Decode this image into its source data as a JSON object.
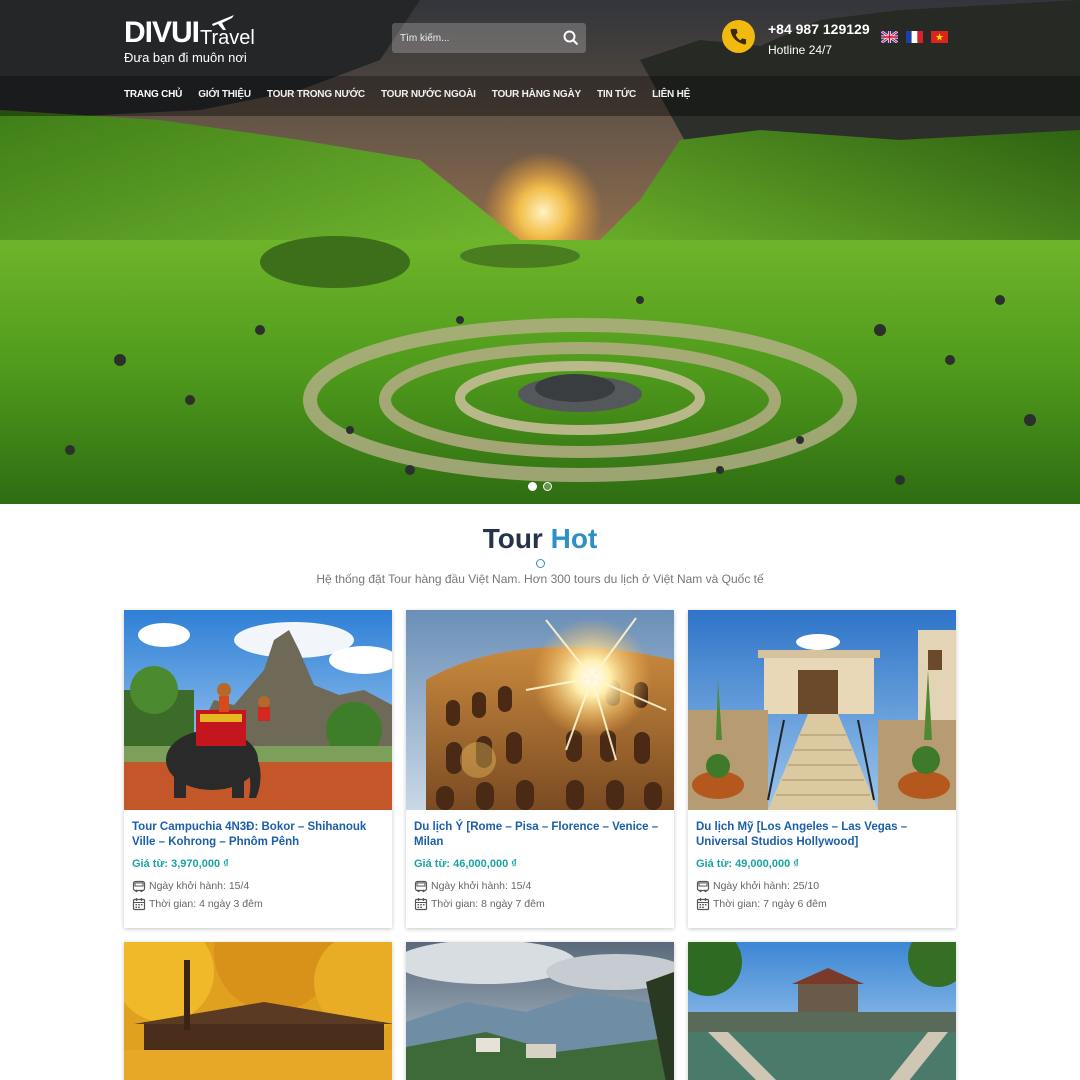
{
  "brand": {
    "name": "DIVUI",
    "sub": "Travel",
    "tagline": "Đưa bạn đi muôn nơi"
  },
  "search": {
    "placeholder": "Tìm kiếm..."
  },
  "hotline": {
    "number": "+84 987 129129",
    "label": "Hotline 24/7"
  },
  "languages": [
    "english-flag",
    "french-flag",
    "vietnam-flag"
  ],
  "nav": [
    {
      "label": "TRANG CHỦ",
      "active": true
    },
    {
      "label": "GIỚI THIỆU"
    },
    {
      "label": "TOUR TRONG NƯỚC"
    },
    {
      "label": "TOUR NƯỚC NGOÀI"
    },
    {
      "label": "TOUR HÀNG NGÀY"
    },
    {
      "label": "TIN TỨC"
    },
    {
      "label": "LIÊN HỆ"
    }
  ],
  "slider": {
    "slide_count": 2,
    "active_slide": 1
  },
  "section": {
    "title_a": "Tour",
    "title_b": "Hot",
    "subtitle": "Hệ thống đặt Tour hàng đầu Việt Nam. Hơn 300 tours du lịch ở Việt Nam và Quốc tế"
  },
  "tours": [
    {
      "title": "Tour Campuchia 4N3Đ: Bokor – Shihanouk Ville – Kohrong – Phnôm Pênh",
      "price": "Giá từ: 3,970,000 ₫",
      "depart": "Ngày khởi hành: 15/4",
      "duration": "Thời gian: 4 ngày 3 đêm"
    },
    {
      "title": "Du lịch Ý [Rome – Pisa – Florence – Venice – Milan",
      "price": "Giá từ: 46,000,000 ₫",
      "depart": "Ngày khởi hành: 15/4",
      "duration": "Thời gian: 8 ngày 7 đêm"
    },
    {
      "title": "Du lịch Mỹ [Los Angeles – Las Vegas – Universal Studios Hollywood]",
      "price": "Giá từ: 49,000,000 ₫",
      "depart": "Ngày khởi hành: 25/10",
      "duration": "Thời gian: 7 ngày 6 đêm"
    }
  ],
  "colors": {
    "accent_blue": "#2e90c8",
    "title_dark": "#25344b",
    "link_blue": "#1b5fa8",
    "price_teal": "#1aa3a3",
    "hotline_yellow": "#f2b90f"
  }
}
